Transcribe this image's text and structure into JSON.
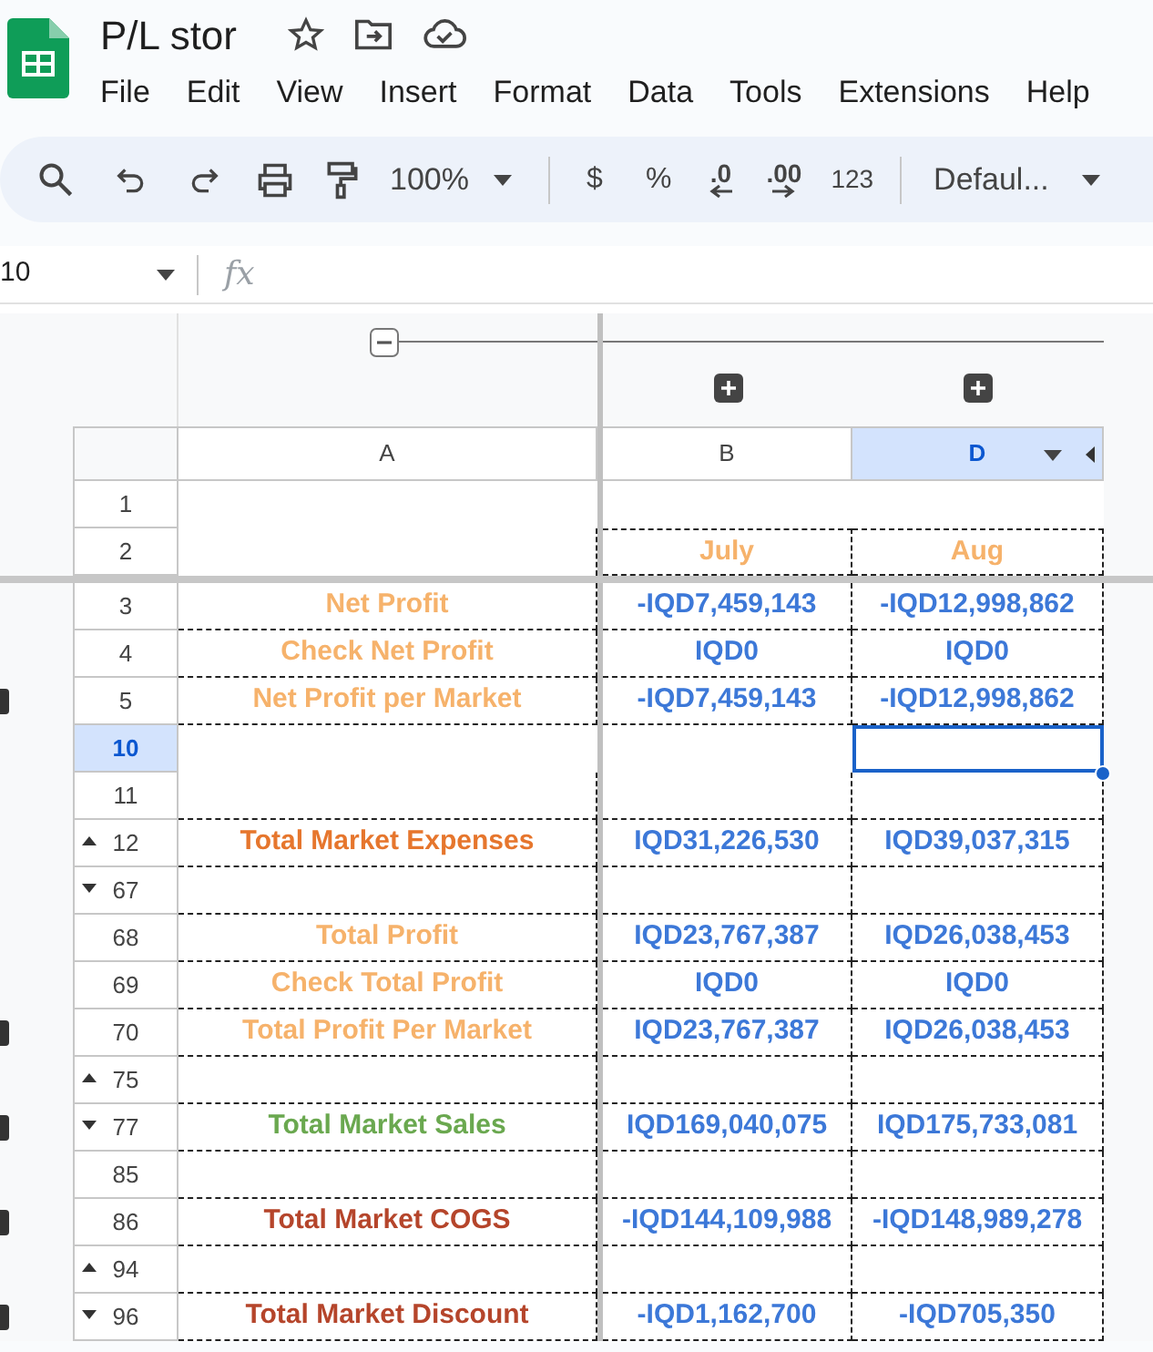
{
  "document": {
    "title": "P/L stor"
  },
  "menu": [
    "File",
    "Edit",
    "View",
    "Insert",
    "Format",
    "Data",
    "Tools",
    "Extensions",
    "Help"
  ],
  "toolbar": {
    "zoom": "100%",
    "currency": "$",
    "percent": "%",
    "decrease_decimals": ".0",
    "increase_decimals": ".00",
    "number_format": "123",
    "font": "Defaul..."
  },
  "name_box": "10",
  "formula_bar": {
    "fx": "fx"
  },
  "column_groups": [
    {
      "expanded": true
    },
    {
      "expanded": false
    },
    {
      "expanded": false
    }
  ],
  "columns": [
    {
      "label": "A",
      "selected": false
    },
    {
      "label": "B",
      "selected": false
    },
    {
      "label": "D",
      "selected": true
    }
  ],
  "rows": [
    {
      "number": "1",
      "selected": false,
      "group_marker": false
    },
    {
      "number": "2",
      "selected": false,
      "group_marker": false,
      "b": "July",
      "d": "Aug",
      "color": "#f6b26b"
    },
    {
      "number": "3",
      "selected": false,
      "group_marker": false,
      "label": "Net Profit",
      "color": "#f6b26b",
      "b": "-IQD7,459,143",
      "d": "-IQD12,998,862"
    },
    {
      "number": "4",
      "selected": false,
      "group_marker": false,
      "label": "Check Net Profit",
      "color": "#f6b26b",
      "b": "IQD0",
      "d": "IQD0"
    },
    {
      "number": "5",
      "selected": false,
      "group_marker": true,
      "label": "Net Profit per Market",
      "color": "#f6b26b",
      "b": "-IQD7,459,143",
      "d": "-IQD12,998,862"
    },
    {
      "number": "10",
      "selected": true,
      "group_marker": false
    },
    {
      "number": "11",
      "selected": false,
      "group_marker": false
    },
    {
      "number": "12",
      "selected": false,
      "group_marker": false,
      "toggle_expanded": false,
      "label": "Total Market Expenses",
      "color": "#e6762d",
      "b": "IQD31,226,530",
      "d": "IQD39,037,315"
    },
    {
      "number": "67",
      "selected": false,
      "group_marker": false,
      "toggle_expanded": true
    },
    {
      "number": "68",
      "selected": false,
      "group_marker": false,
      "label": "Total Profit",
      "color": "#f6b26b",
      "b": "IQD23,767,387",
      "d": "IQD26,038,453"
    },
    {
      "number": "69",
      "selected": false,
      "group_marker": false,
      "label": "Check Total Profit",
      "color": "#f6b26b",
      "b": "IQD0",
      "d": "IQD0"
    },
    {
      "number": "70",
      "selected": false,
      "group_marker": true,
      "label": "Total Profit Per Market",
      "color": "#f6b26b",
      "b": "IQD23,767,387",
      "d": "IQD26,038,453"
    },
    {
      "number": "75",
      "selected": false,
      "group_marker": false,
      "toggle_expanded": false
    },
    {
      "number": "77",
      "selected": false,
      "group_marker": true,
      "toggle_expanded": true,
      "label": "Total Market Sales",
      "color": "#6aa84f",
      "b": "IQD169,040,075",
      "d": "IQD175,733,081"
    },
    {
      "number": "85",
      "selected": false,
      "group_marker": false
    },
    {
      "number": "86",
      "selected": false,
      "group_marker": true,
      "label": "Total Market COGS",
      "color": "#b5452b",
      "b": "-IQD144,109,988",
      "d": "-IQD148,989,278"
    },
    {
      "number": "94",
      "selected": false,
      "group_marker": false,
      "toggle_expanded": false
    },
    {
      "number": "96",
      "selected": false,
      "group_marker": true,
      "toggle_expanded": true,
      "label": "Total  Market Discount",
      "color": "#b5452b",
      "b": "-IQD1,162,700",
      "d": "-IQD705,350"
    }
  ]
}
